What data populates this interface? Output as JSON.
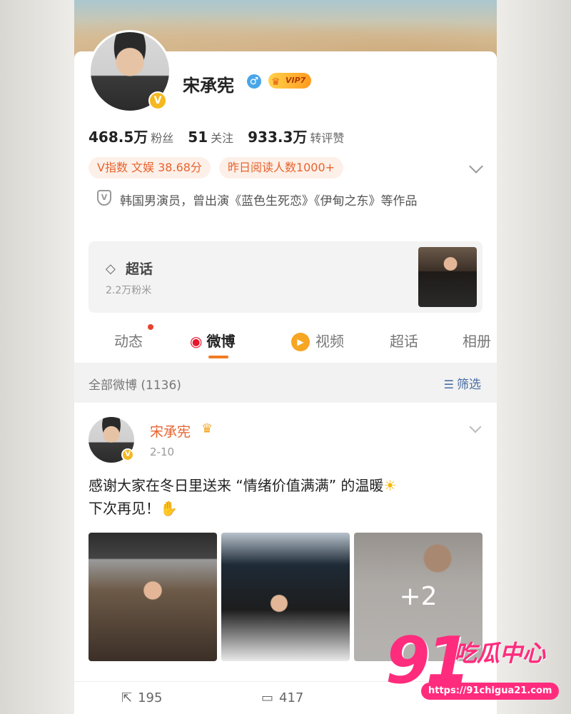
{
  "profile": {
    "name": "宋承宪",
    "gender_icon": "male-icon",
    "vip_label": "VIP7",
    "verified_badge": "V",
    "stats": [
      {
        "value": "468.5万",
        "label": "粉丝"
      },
      {
        "value": "51",
        "label": "关注"
      },
      {
        "value": "933.3万",
        "label": "转评赞"
      }
    ],
    "pills": [
      "V指数 文娱 38.68分",
      "昨日阅读人数1000+"
    ],
    "bio_icon_glyph": "V",
    "bio": "韩国男演员，曾出演《蓝色生死恋》《伊甸之东》等作品"
  },
  "supertopic": {
    "title": "超话",
    "subtitle": "2.2万粉米"
  },
  "tabs": [
    {
      "label": "动态"
    },
    {
      "label": "微博"
    },
    {
      "label": "视频"
    },
    {
      "label": "超话"
    },
    {
      "label": "相册"
    }
  ],
  "filter": {
    "label": "全部微博 (1136)",
    "button": "筛选"
  },
  "post": {
    "author": "宋承宪",
    "date": "2-10",
    "text_line1": "感谢大家在冬日里送来 “情绪价值满满” 的温暖",
    "text_line2": "下次再见！",
    "more_photos": "+2",
    "actions": {
      "repost": "195",
      "comment": "417"
    }
  },
  "watermark": {
    "logo_number": "91",
    "logo_text": "吃瓜中心",
    "url": "https://91chigua21.com"
  },
  "colors": {
    "accent_orange": "#e8632e",
    "link_blue": "#4a6fa5",
    "watermark_pink": "#ff2c7d"
  }
}
